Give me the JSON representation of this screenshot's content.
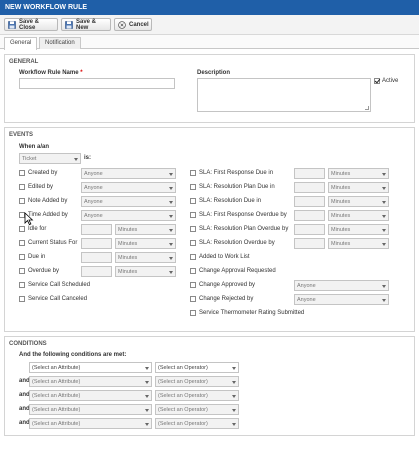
{
  "window": {
    "title": "NEW WORKFLOW RULE"
  },
  "toolbar": {
    "save_close": "Save & Close",
    "save_new": "Save & New",
    "cancel": "Cancel"
  },
  "tabs": [
    "General",
    "Notification"
  ],
  "general": {
    "section_title": "GENERAL",
    "rule_name_label": "Workflow Rule Name",
    "required_mark": "*",
    "rule_name_value": "",
    "description_label": "Description",
    "description_value": "",
    "active_label": "Active",
    "active_checked": true
  },
  "events": {
    "section_title": "EVENTS",
    "when_label": "When a/an",
    "entity_value": "Ticket",
    "is_label": "is:",
    "left": [
      {
        "label": "Created by",
        "checked": false,
        "select": "Anyone"
      },
      {
        "label": "Edited by",
        "checked": false,
        "select": "Anyone"
      },
      {
        "label": "Note Added by",
        "checked": false,
        "select": "Anyone"
      },
      {
        "label": "Time Added by",
        "checked": false,
        "select": "Anyone"
      },
      {
        "label": "Idle for",
        "checked": false,
        "units": "Minutes"
      },
      {
        "label": "Current Status For",
        "checked": false,
        "units": "Minutes"
      },
      {
        "label": "Due in",
        "checked": false,
        "units": "Minutes"
      },
      {
        "label": "Overdue by",
        "checked": false,
        "units": "Minutes"
      },
      {
        "label": "Service Call Scheduled",
        "checked": false
      },
      {
        "label": "Service Call Canceled",
        "checked": false
      }
    ],
    "right": [
      {
        "label": "SLA: First Response Due in",
        "checked": false,
        "units": "Minutes"
      },
      {
        "label": "SLA: Resolution Plan Due in",
        "checked": false,
        "units": "Minutes"
      },
      {
        "label": "SLA: Resolution Due in",
        "checked": false,
        "units": "Minutes"
      },
      {
        "label": "SLA: First Response Overdue by",
        "checked": false,
        "units": "Minutes"
      },
      {
        "label": "SLA: Resolution Plan Overdue by",
        "checked": false,
        "units": "Minutes"
      },
      {
        "label": "SLA: Resolution Overdue by",
        "checked": false,
        "units": "Minutes"
      },
      {
        "label": "Added to Work List",
        "checked": false
      },
      {
        "label": "Change Approval Requested",
        "checked": false
      },
      {
        "label": "Change Approved by",
        "checked": false,
        "select": "Anyone"
      },
      {
        "label": "Change Rejected by",
        "checked": false,
        "select": "Anyone"
      },
      {
        "label": "Service Thermometer Rating Submitted",
        "checked": false
      }
    ]
  },
  "conditions": {
    "section_title": "CONDITIONS",
    "intro": "And the following conditions are met:",
    "and_label": "and",
    "rows": [
      {
        "attribute": "(Select an Attribute)",
        "operator": "(Select an Operator)"
      },
      {
        "attribute": "(Select an Attribute)",
        "operator": "(Select an Operator)"
      },
      {
        "attribute": "(Select an Attribute)",
        "operator": "(Select an Operator)"
      },
      {
        "attribute": "(Select an Attribute)",
        "operator": "(Select an Operator)"
      },
      {
        "attribute": "(Select an Attribute)",
        "operator": "(Select an Operator)"
      }
    ]
  },
  "colors": {
    "title_bar": "#1f5fa8",
    "accent_red": "#d00000"
  }
}
